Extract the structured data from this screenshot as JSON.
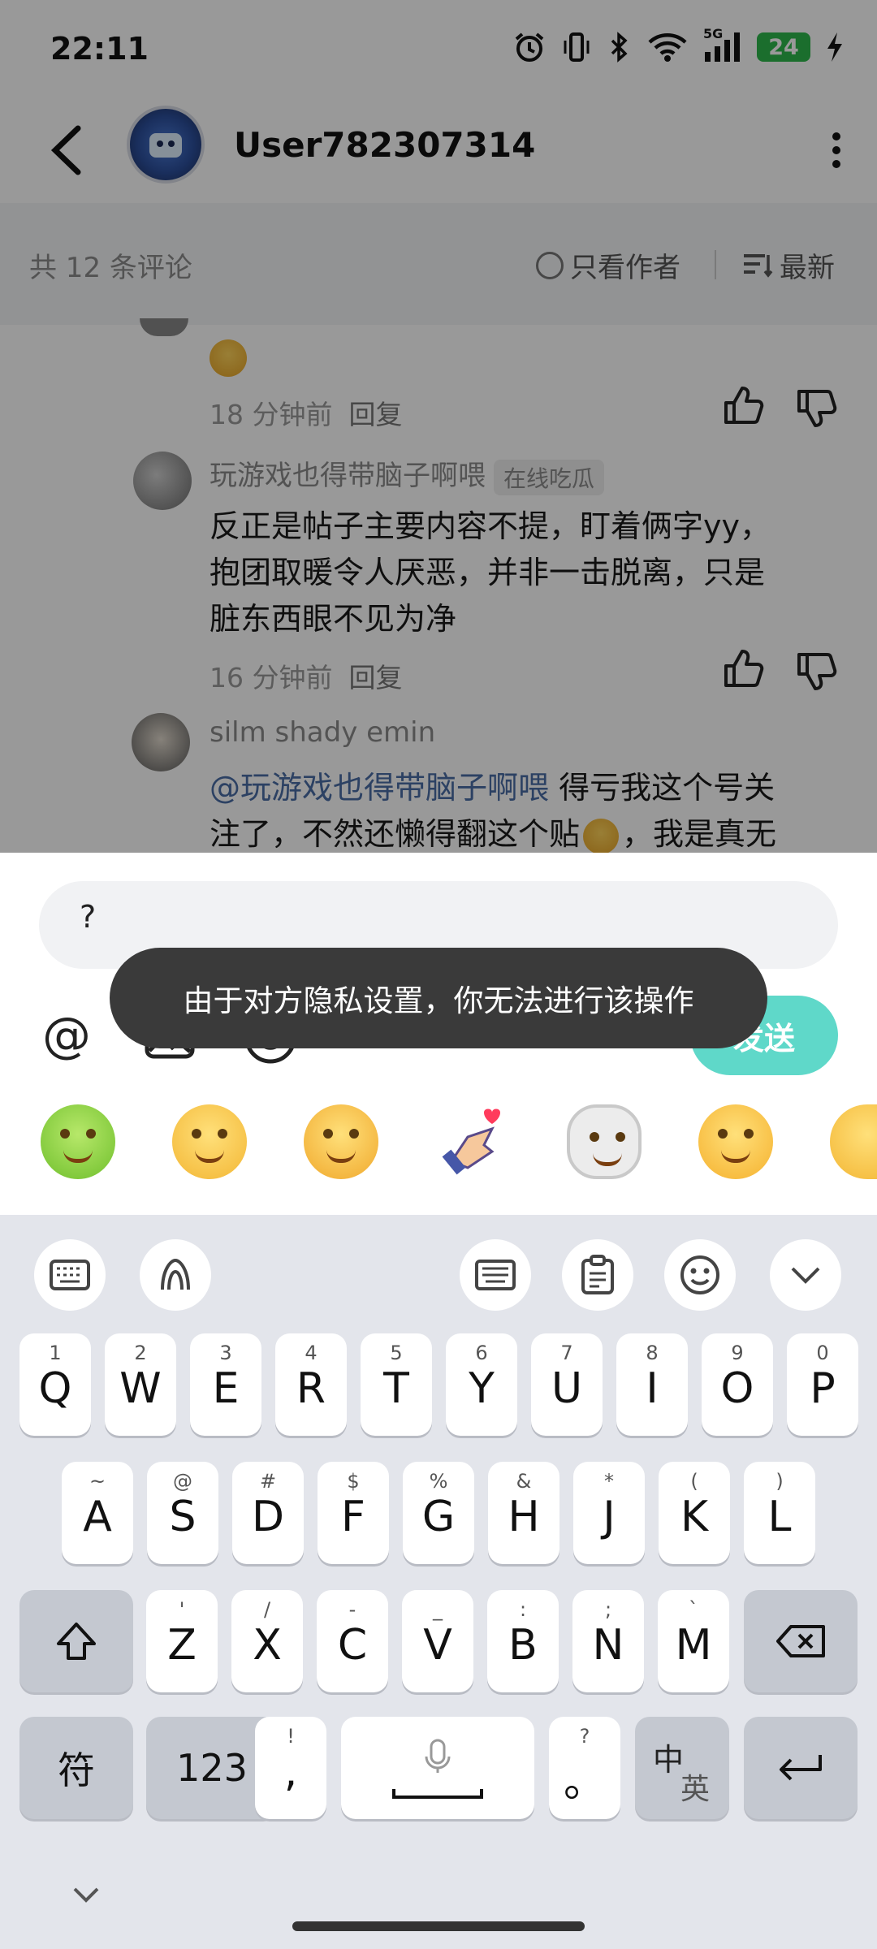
{
  "status": {
    "time": "22:11",
    "battery": "24",
    "network": "5G"
  },
  "header": {
    "username": "User782307314"
  },
  "filters": {
    "count": "共 12 条评论",
    "only_author": "只看作者",
    "sort": "最新"
  },
  "comments": [
    {
      "meta_time": "18 分钟前",
      "reply": "回复"
    },
    {
      "name": "玩游戏也得带脑子啊喂",
      "tag": "在线吃瓜",
      "line1": "反正是帖子主要内容不提，盯着俩字yy，",
      "line2": "抱团取暖令人厌恶，并非一击脱离，只是",
      "line3": "脏东西眼不见为净",
      "meta_time": "16 分钟前",
      "reply": "回复"
    },
    {
      "name": "silm shady emin",
      "mention": "@玩游戏也得带脑子啊喂",
      "line1_rest": " 得亏我这个号关",
      "line2": "注了，不然还懒得翻这个贴",
      "line2_end": "，我是真无"
    }
  ],
  "composer": {
    "input_value": "?",
    "at_symbol": "@",
    "send_label": "发送"
  },
  "toast": {
    "message": "由于对方隐私设置，你无法进行该操作"
  },
  "keyboard": {
    "row1": [
      {
        "hint": "1",
        "key": "Q"
      },
      {
        "hint": "2",
        "key": "W"
      },
      {
        "hint": "3",
        "key": "E"
      },
      {
        "hint": "4",
        "key": "R"
      },
      {
        "hint": "5",
        "key": "T"
      },
      {
        "hint": "6",
        "key": "Y"
      },
      {
        "hint": "7",
        "key": "U"
      },
      {
        "hint": "8",
        "key": "I"
      },
      {
        "hint": "9",
        "key": "O"
      },
      {
        "hint": "0",
        "key": "P"
      }
    ],
    "row2": [
      {
        "hint": "~",
        "key": "A"
      },
      {
        "hint": "@",
        "key": "S"
      },
      {
        "hint": "#",
        "key": "D"
      },
      {
        "hint": "$",
        "key": "F"
      },
      {
        "hint": "%",
        "key": "G"
      },
      {
        "hint": "&",
        "key": "H"
      },
      {
        "hint": "*",
        "key": "J"
      },
      {
        "hint": "(",
        "key": "K"
      },
      {
        "hint": ")",
        "key": "L"
      }
    ],
    "row3": [
      {
        "hint": "'",
        "key": "Z"
      },
      {
        "hint": "/",
        "key": "X"
      },
      {
        "hint": "-",
        "key": "C"
      },
      {
        "hint": "_",
        "key": "V"
      },
      {
        "hint": ":",
        "key": "B"
      },
      {
        "hint": ";",
        "key": "N"
      },
      {
        "hint": "`",
        "key": "M"
      }
    ],
    "symbols_key": "符",
    "numbers_key": "123",
    "comma_hint": "!",
    "comma_key": ",",
    "period_hint": "?",
    "period_key": "。",
    "lang_zh": "中",
    "lang_en": "英"
  },
  "colors": {
    "send": "#5fd8c9",
    "toast": "#3a3a3a",
    "keyboard_bg": "#e3e5eb",
    "battery": "#2db84c"
  }
}
